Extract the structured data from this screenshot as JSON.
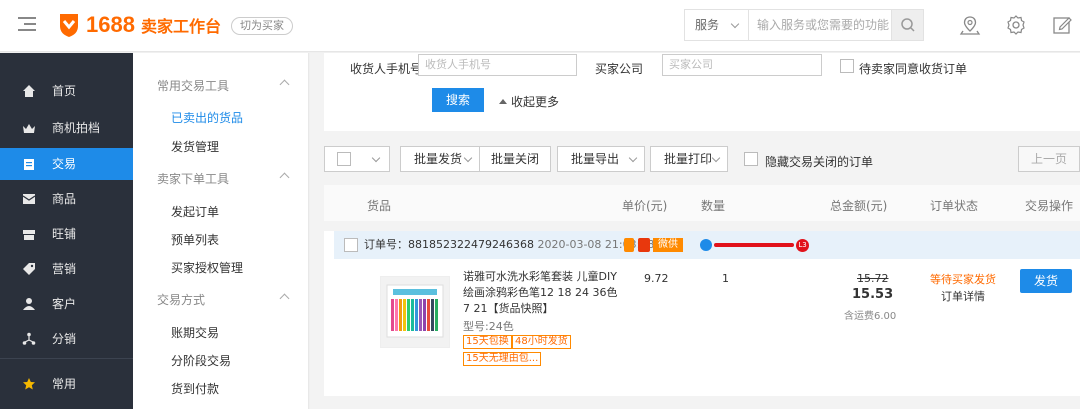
{
  "header": {
    "logo_number": "1688",
    "logo_text": "卖家工作台",
    "switch_label": "切为买家",
    "search_type": "服务",
    "search_placeholder": "输入服务或您需要的功能"
  },
  "sidebar": {
    "items": [
      {
        "label": "首页",
        "icon": "home-icon"
      },
      {
        "label": "商机拍档",
        "icon": "crown-icon"
      },
      {
        "label": "交易",
        "icon": "clipboard-icon",
        "active": true
      },
      {
        "label": "商品",
        "icon": "box-icon"
      },
      {
        "label": "旺铺",
        "icon": "shop-icon"
      },
      {
        "label": "营销",
        "icon": "tag-icon"
      },
      {
        "label": "客户",
        "icon": "user-icon"
      },
      {
        "label": "分销",
        "icon": "share-icon"
      },
      {
        "label": "常用",
        "icon": "star-icon"
      }
    ]
  },
  "submenu": {
    "groups": [
      {
        "title": "常用交易工具",
        "items": [
          "已卖出的货品",
          "发货管理"
        ]
      },
      {
        "title": "卖家下单工具",
        "items": [
          "发起订单",
          "预单列表",
          "买家授权管理"
        ]
      },
      {
        "title": "交易方式",
        "items": [
          "账期交易",
          "分阶段交易",
          "货到付款"
        ]
      }
    ]
  },
  "filters": {
    "phone_label": "收货人手机号",
    "phone_placeholder": "收货人手机号",
    "company_label": "买家公司",
    "company_placeholder": "买家公司",
    "pending_label": "待卖家同意收货订单",
    "search_button": "搜索",
    "collapse_label": "收起更多"
  },
  "toolbar": {
    "batch_ship": "批量发货",
    "batch_close": "批量关闭",
    "batch_export": "批量导出",
    "batch_print": "批量打印",
    "hide_closed": "隐藏交易关闭的订单",
    "prev_page": "上一页"
  },
  "table": {
    "headers": [
      "货品",
      "单价(元)",
      "数量",
      "总金额(元)",
      "订单状态",
      "交易操作"
    ]
  },
  "order": {
    "number_label": "订单号：881852322479246368",
    "date": "2020-03-08 21:03:58",
    "wechat_tag": "微供",
    "buyer_badge": "L3",
    "title": "诺雅可水洗水彩笔套装 儿童DIY绘画涂鸦彩色笔12 18 24 36色7 21【货品快照】",
    "spec": "型号:24色",
    "tags": [
      "15天包换",
      "48小时发货",
      "15天无理由包..."
    ],
    "unit_price": "9.72",
    "quantity": "1",
    "total_old": "15.72",
    "total_new": "15.53",
    "freight": "含运费6.00",
    "status": "等待买家发货",
    "detail_link": "订单详情",
    "ship_button": "发货"
  },
  "colors": {
    "accent": "#1e8be8",
    "brand": "#ff6a00",
    "sidebar_bg": "#2a303b"
  }
}
